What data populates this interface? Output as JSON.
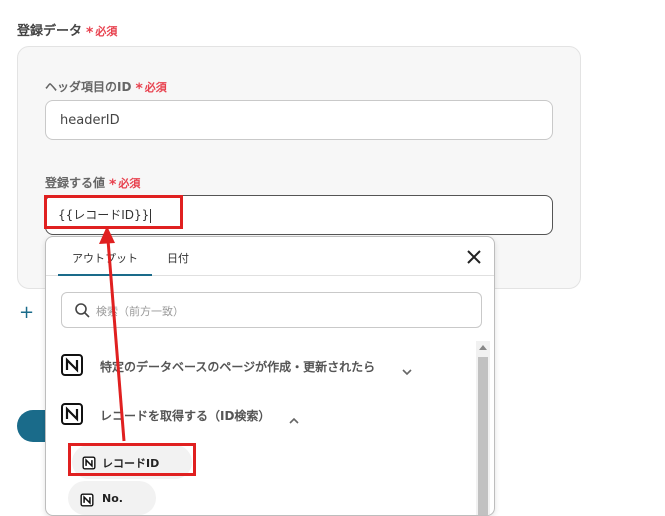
{
  "section": {
    "label": "登録データ",
    "required": "必須"
  },
  "header_id": {
    "label": "ヘッダ項目のID",
    "required": "必須",
    "value": "headerID"
  },
  "register_value": {
    "label": "登録する値",
    "required": "必須",
    "value": "{{レコードID}}"
  },
  "dropdown": {
    "tabs": [
      "アウトプット",
      "日付"
    ],
    "search_placeholder": "検索（前方一致）",
    "groups": [
      {
        "label": "特定のデータベースのページが作成・更新されたら",
        "expanded": false
      },
      {
        "label": "レコードを取得する（ID検索）",
        "expanded": true
      }
    ],
    "items": [
      "レコードID",
      "No."
    ]
  },
  "add_label": "+",
  "colors": {
    "accent": "#1a6b8a",
    "required": "#e8424f",
    "highlight": "#e02020"
  },
  "icons": {
    "close": "close-icon",
    "search": "search-icon",
    "notion": "notion-icon"
  }
}
